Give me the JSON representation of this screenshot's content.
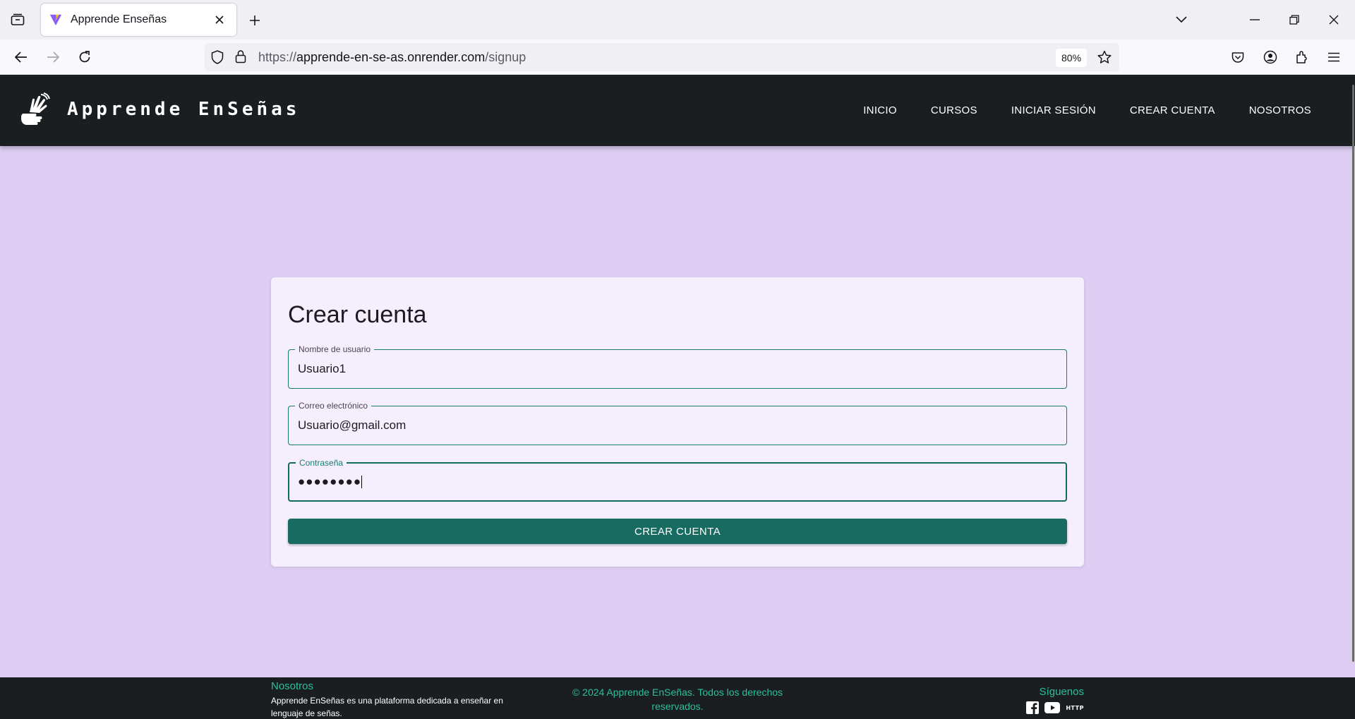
{
  "browser": {
    "tab": {
      "title": "Apprende Enseñas"
    },
    "url": {
      "protocol": "https://",
      "host": "apprende-en-se-as.onrender.com",
      "path": "/signup"
    },
    "zoom": "80%"
  },
  "site": {
    "brand": "Apprende EnSeñas",
    "nav": [
      "INICIO",
      "CURSOS",
      "INICIAR SESIÓN",
      "CREAR CUENTA",
      "NOSOTROS"
    ]
  },
  "signup": {
    "title": "Crear cuenta",
    "username": {
      "label": "Nombre de usuario",
      "value": "Usuario1"
    },
    "email": {
      "label": "Correo electrónico",
      "value": "Usuario@gmail.com"
    },
    "password": {
      "label": "Contraseña",
      "masked": "●●●●●●●●"
    },
    "submit": "CREAR CUENTA"
  },
  "footer": {
    "about_heading": "Nosotros",
    "about_text": "Apprende EnSeñas es una plataforma dedicada a enseñar en lenguaje de señas.",
    "copyright": "© 2024 Apprende EnSeñas. Todos los derechos reservados.",
    "follow": "Síguenos",
    "social_http": "HTTP"
  },
  "colors": {
    "page_bg": "#ddcdf3",
    "header_bg": "#1b1e21",
    "accent": "#176b61",
    "footer_text": "#2bbf9e"
  },
  "icons": [
    "tab-list-icon",
    "vite-favicon",
    "close-icon",
    "plus-icon",
    "chevron-down-icon",
    "minimize-icon",
    "restore-icon",
    "window-close-icon",
    "back-icon",
    "forward-icon",
    "reload-icon",
    "shield-icon",
    "lock-icon",
    "star-icon",
    "pocket-icon",
    "account-icon",
    "extensions-icon",
    "menu-icon",
    "hand-sign-icon",
    "facebook-icon",
    "youtube-icon"
  ]
}
